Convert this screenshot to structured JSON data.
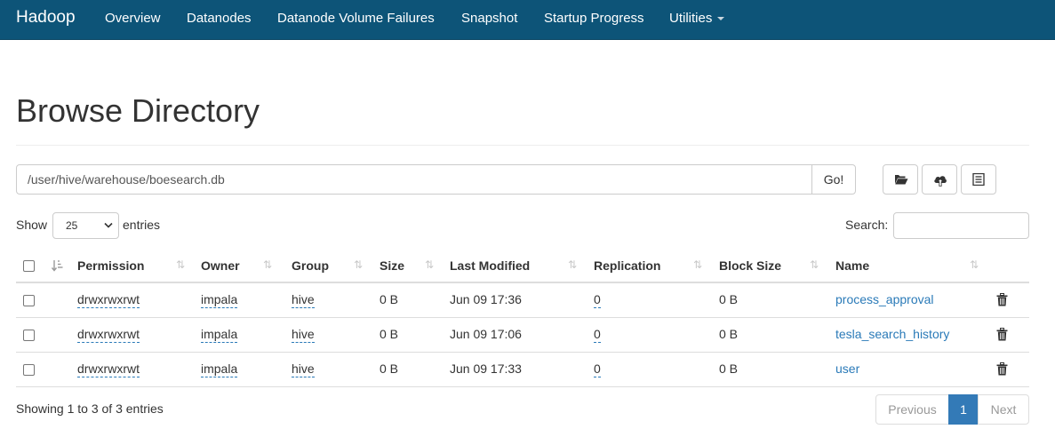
{
  "navbar": {
    "brand": "Hadoop",
    "items": [
      {
        "label": "Overview"
      },
      {
        "label": "Datanodes"
      },
      {
        "label": "Datanode Volume Failures"
      },
      {
        "label": "Snapshot"
      },
      {
        "label": "Startup Progress"
      },
      {
        "label": "Utilities"
      }
    ],
    "background": "#0d5478"
  },
  "page": {
    "title": "Browse Directory"
  },
  "path_bar": {
    "path": "/user/hive/warehouse/boesearch.db",
    "go_label": "Go!",
    "tools": [
      "folder-open-icon",
      "upload-icon",
      "list-icon"
    ]
  },
  "table_controls": {
    "show_label": "Show",
    "page_length": "25",
    "entries_label": "entries",
    "search_label": "Search:",
    "search_value": ""
  },
  "table": {
    "columns": [
      "Permission",
      "Owner",
      "Group",
      "Size",
      "Last Modified",
      "Replication",
      "Block Size",
      "Name"
    ],
    "rows": [
      {
        "permission": "drwxrwxrwt",
        "owner": "impala",
        "group": "hive",
        "size": "0 B",
        "last_modified": "Jun 09 17:36",
        "replication": "0",
        "block_size": "0 B",
        "name": "process_approval"
      },
      {
        "permission": "drwxrwxrwt",
        "owner": "impala",
        "group": "hive",
        "size": "0 B",
        "last_modified": "Jun 09 17:06",
        "replication": "0",
        "block_size": "0 B",
        "name": "tesla_search_history"
      },
      {
        "permission": "drwxrwxrwt",
        "owner": "impala",
        "group": "hive",
        "size": "0 B",
        "last_modified": "Jun 09 17:33",
        "replication": "0",
        "block_size": "0 B",
        "name": "user"
      }
    ]
  },
  "footer": {
    "info": "Showing 1 to 3 of 3 entries",
    "previous": "Previous",
    "current_page": "1",
    "next": "Next"
  },
  "colors": {
    "link": "#2a7ab8",
    "active_page": "#337ab7"
  }
}
